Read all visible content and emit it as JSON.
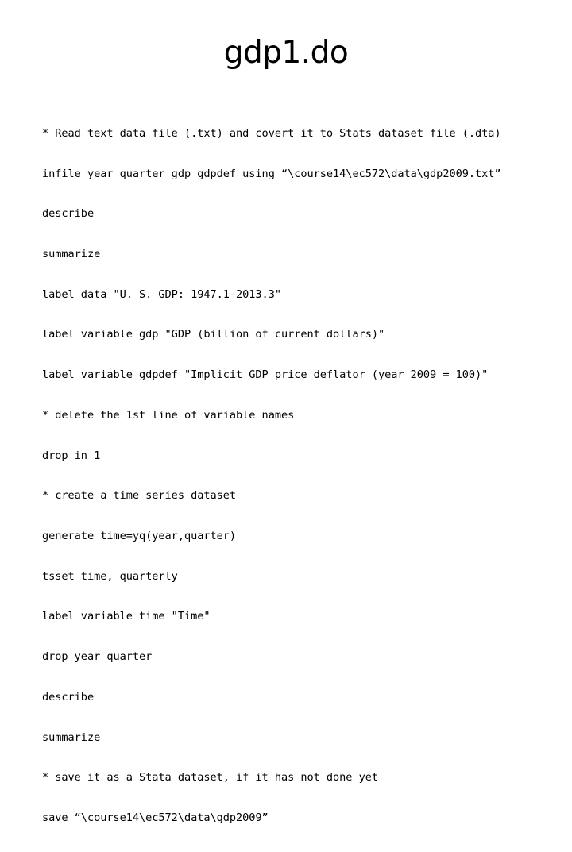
{
  "slide": {
    "title": "gdp1.do",
    "background_color": "#ffffff",
    "text_color": "#000000",
    "code_lines": [
      "* Read text data file (.txt) and covert it to Stats dataset file (.dta)",
      "infile year quarter gdp gdpdef using “\\course14\\ec572\\data\\gdp2009.txt”",
      "describe",
      "summarize",
      "label data \"U. S. GDP: 1947.1-2013.3\"",
      "label variable gdp \"GDP (billion of current dollars)\"",
      "label variable gdpdef \"Implicit GDP price deflator (year 2009 = 100)\"",
      "* delete the 1st line of variable names",
      "drop in 1",
      "* create a time series dataset",
      "generate time=yq(year,quarter)",
      "tsset time, quarterly",
      "label variable time \"Time\"",
      "drop year quarter",
      "describe",
      "summarize",
      "* save it as a Stata dataset, if it has not done yet",
      "save “\\course14\\ec572\\data\\gdp2009”"
    ]
  }
}
